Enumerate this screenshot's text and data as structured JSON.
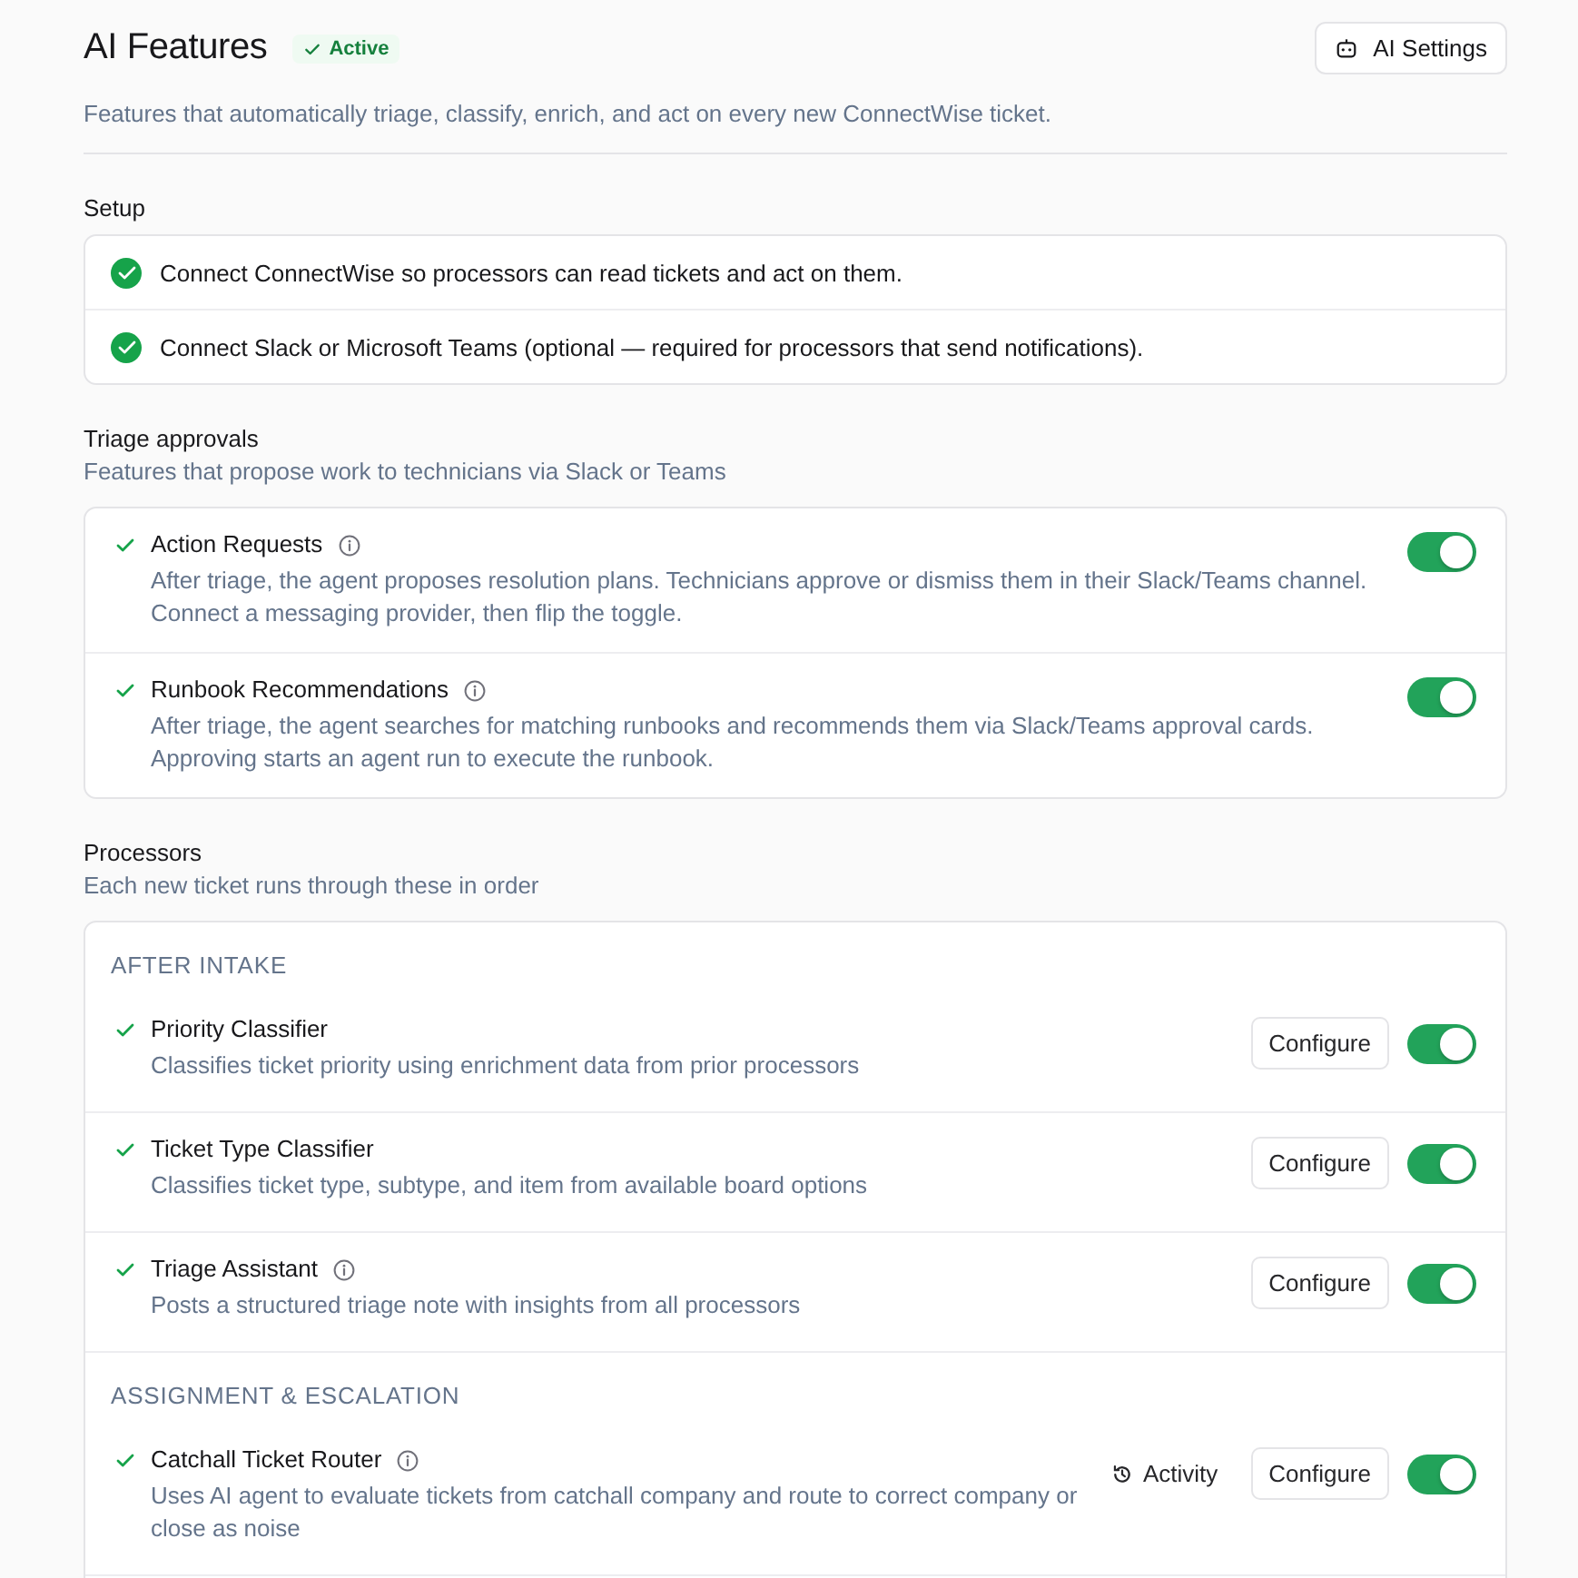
{
  "header": {
    "title": "AI Features",
    "status_badge": "Active",
    "settings_button": "AI Settings",
    "subtitle": "Features that automatically triage, classify, enrich, and act on every new ConnectWise ticket."
  },
  "setup": {
    "title": "Setup",
    "items": [
      {
        "text": "Connect ConnectWise so processors can read tickets and act on them.",
        "done": true
      },
      {
        "text": "Connect Slack or Microsoft Teams (optional — required for processors that send notifications).",
        "done": true
      }
    ]
  },
  "triage_approvals": {
    "title": "Triage approvals",
    "subtitle": "Features that propose work to technicians via Slack or Teams",
    "features": [
      {
        "name": "Action Requests",
        "info": true,
        "description": "After triage, the agent proposes resolution plans. Technicians approve or dismiss them in their Slack/Teams channel. Connect a messaging provider, then flip the toggle.",
        "ready": true,
        "on": true
      },
      {
        "name": "Runbook Recommendations",
        "info": true,
        "description": "After triage, the agent searches for matching runbooks and recommends them via Slack/Teams approval cards. Approving starts an agent run to execute the runbook.",
        "ready": true,
        "on": true
      }
    ]
  },
  "processors": {
    "title": "Processors",
    "subtitle": "Each new ticket runs through these in order",
    "groups": [
      {
        "title": "AFTER INTAKE",
        "items": [
          {
            "name": "Priority Classifier",
            "info": false,
            "description": "Classifies ticket priority using enrichment data from prior processors",
            "ready": true,
            "configure": "Configure",
            "on": true
          },
          {
            "name": "Ticket Type Classifier",
            "info": false,
            "description": "Classifies ticket type, subtype, and item from available board options",
            "ready": true,
            "configure": "Configure",
            "on": true
          },
          {
            "name": "Triage Assistant",
            "info": true,
            "description": "Posts a structured triage note with insights from all processors",
            "ready": true,
            "configure": "Configure",
            "on": true
          }
        ]
      },
      {
        "title": "ASSIGNMENT & ESCALATION",
        "items": [
          {
            "name": "Catchall Ticket Router",
            "info": true,
            "description": "Uses AI agent to evaluate tickets from catchall company and route to correct company or close as noise",
            "ready": true,
            "activity": "Activity",
            "configure": "Configure",
            "on": true
          }
        ]
      }
    ]
  }
}
